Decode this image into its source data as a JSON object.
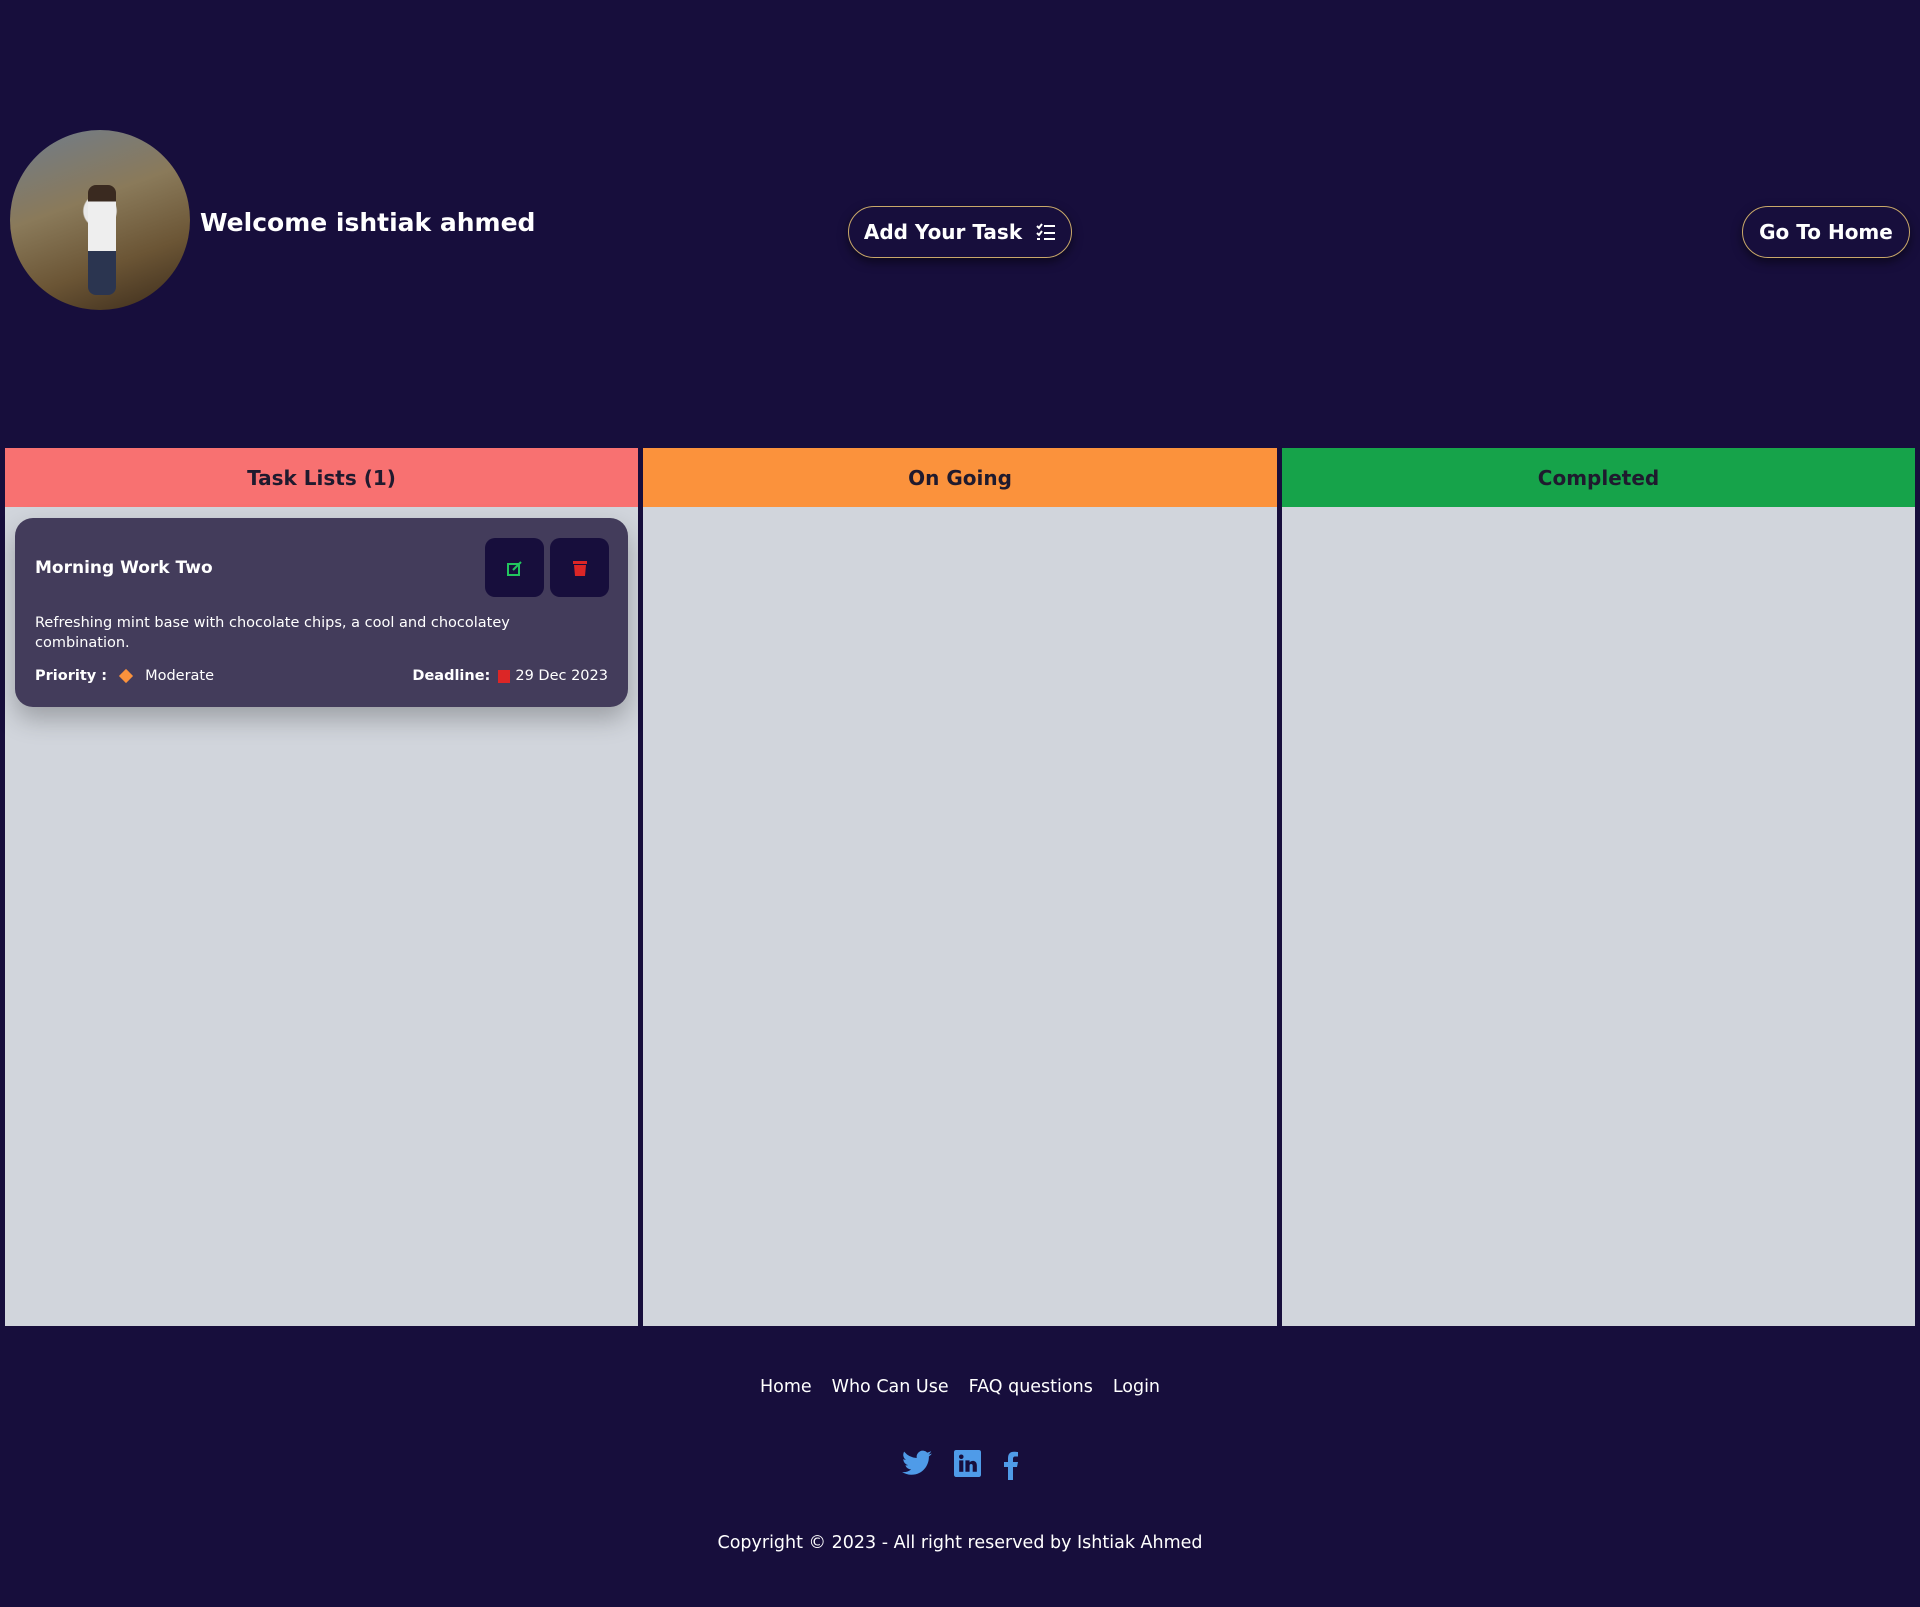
{
  "header": {
    "welcome": "Welcome ishtiak ahmed",
    "add_task": "Add Your Task",
    "go_home": "Go To Home"
  },
  "columns": [
    {
      "title": "Task Lists (1)",
      "color": "#f87171"
    },
    {
      "title": "On Going",
      "color": "#fb923c"
    },
    {
      "title": "Completed",
      "color": "#16a34a"
    }
  ],
  "tasks": [
    {
      "title": "Morning Work Two",
      "description": "Refreshing mint base with chocolate chips, a cool and chocolatey combination.",
      "priority_label": "Priority :",
      "priority": "Moderate",
      "deadline_label": "Deadline:",
      "deadline": "29 Dec 2023"
    }
  ],
  "footer": {
    "links": [
      "Home",
      "Who Can Use",
      "FAQ questions",
      "Login"
    ],
    "social": [
      "twitter-icon",
      "linkedin-icon",
      "facebook-icon"
    ],
    "copyright": "Copyright © 2023 - All right reserved by Ishtiak Ahmed"
  }
}
